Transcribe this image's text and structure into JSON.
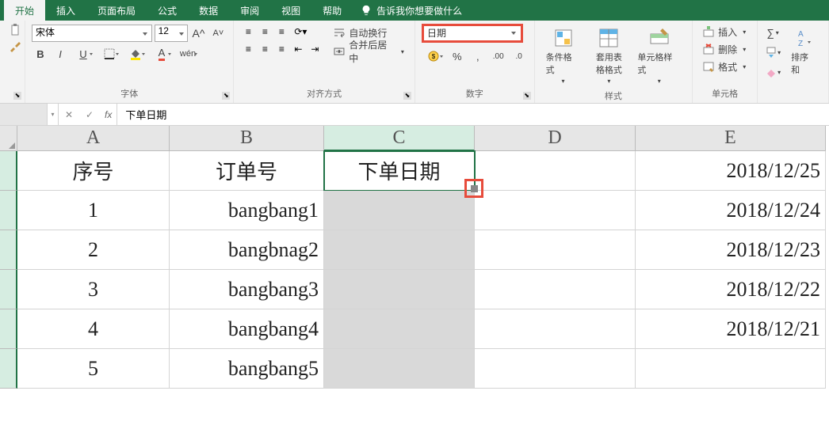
{
  "menu": {
    "items": [
      "开始",
      "插入",
      "页面布局",
      "公式",
      "数据",
      "审阅",
      "视图",
      "帮助"
    ],
    "tellme": "告诉我你想要做什么"
  },
  "ribbon": {
    "font_group_label": "字体",
    "align_group_label": "对齐方式",
    "number_group_label": "数字",
    "styles_group_label": "样式",
    "cells_group_label": "单元格",
    "font_family": "宋体",
    "font_size": "12",
    "wrap_text": "自动换行",
    "merge_center": "合并后居中",
    "number_format": "日期",
    "cond_format": "条件格式",
    "format_table": "套用表格格式",
    "cell_styles": "单元格样式",
    "insert": "插入",
    "delete": "删除",
    "format": "格式",
    "sort_filter": "排序和"
  },
  "formula_bar": {
    "cell_ref": "",
    "fx": "fx",
    "value": "下单日期"
  },
  "columns": [
    "A",
    "B",
    "C",
    "D",
    "E"
  ],
  "sheet": {
    "headers": {
      "a": "序号",
      "b": "订单号",
      "c": "下单日期",
      "d": "",
      "e": "2018/12/25"
    },
    "rows": [
      {
        "a": "1",
        "b": "bangbang1",
        "c": "",
        "d": "",
        "e": "2018/12/24"
      },
      {
        "a": "2",
        "b": "bangbnag2",
        "c": "",
        "d": "",
        "e": "2018/12/23"
      },
      {
        "a": "3",
        "b": "bangbang3",
        "c": "",
        "d": "",
        "e": "2018/12/22"
      },
      {
        "a": "4",
        "b": "bangbang4",
        "c": "",
        "d": "",
        "e": "2018/12/21"
      },
      {
        "a": "5",
        "b": "bangbang5",
        "c": "",
        "d": "",
        "e": ""
      }
    ]
  }
}
